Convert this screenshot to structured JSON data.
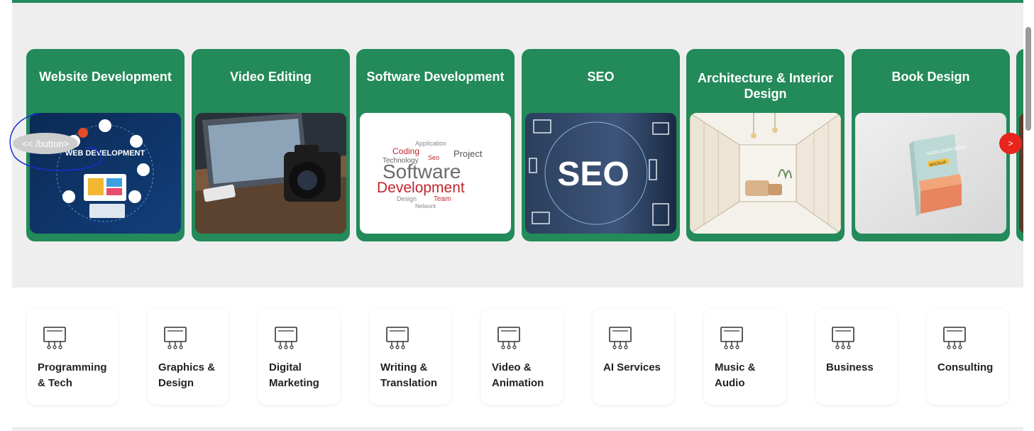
{
  "carousel": {
    "prev_label": "<< /button>",
    "next_label": ">",
    "cards": [
      {
        "title": "Website Development",
        "image": "web-development-illustration",
        "overlay": "WEB DEVELOPMENT"
      },
      {
        "title": "Video Editing",
        "image": "laptop-camera-desk-photo"
      },
      {
        "title": "Software Development",
        "image": "software-word-cloud",
        "word1": "Software",
        "word2": "Development",
        "small_words": [
          "Application",
          "Coding",
          "Project",
          "Technology",
          "Team",
          "Network",
          "Design",
          "Seo"
        ]
      },
      {
        "title": "SEO",
        "image": "seo-devices-photo",
        "overlay": "SEO"
      },
      {
        "title": "Architecture & Interior Design",
        "image": "interior-sketch"
      },
      {
        "title": "Book Design",
        "image": "hardcover-book-mockup",
        "book_text": "HARDCOVER BOOK",
        "book_badge": "MOCKUP"
      }
    ]
  },
  "categories": [
    {
      "label": "Programming & Tech"
    },
    {
      "label": "Graphics & Design"
    },
    {
      "label": "Digital Marketing"
    },
    {
      "label": "Writing & Translation"
    },
    {
      "label": "Video & Animation"
    },
    {
      "label": "AI Services"
    },
    {
      "label": "Music & Audio"
    },
    {
      "label": "Business"
    },
    {
      "label": "Consulting"
    }
  ],
  "colors": {
    "brand": "#238a59",
    "accent": "#e8251d"
  }
}
